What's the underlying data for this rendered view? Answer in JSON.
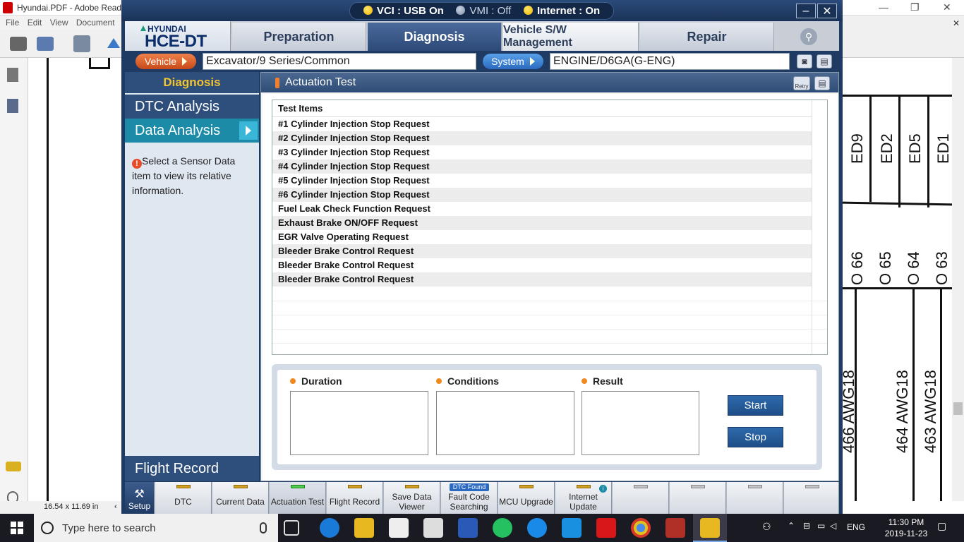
{
  "background": {
    "title": "Hyundai.PDF - Adobe Reade",
    "menu": [
      "File",
      "Edit",
      "View",
      "Document"
    ],
    "page_size": "16.54 x 11.69 in",
    "schematic_labels": [
      "ED9",
      "ED2",
      "ED5",
      "ED1"
    ],
    "pin_labels": [
      "O 66",
      "O 65",
      "O 64",
      "O 63"
    ],
    "wire_labels": [
      "466 AWG18",
      "464 AWG18",
      "463 AWG18"
    ]
  },
  "app": {
    "status": {
      "vci": "VCI : USB On",
      "vmi": "VMI : Off",
      "internet": "Internet : On"
    },
    "logo_brand": "HYUNDAI",
    "logo_product": "HCE-DT",
    "tabs": [
      "Preparation",
      "Diagnosis",
      "Vehicle S/W Management",
      "Repair"
    ],
    "vehicle_label": "Vehicle",
    "vehicle_value": "Excavator/9 Series/Common",
    "system_label": "System",
    "system_value": "ENGINE/D6GA(G-ENG)"
  },
  "sidebar": {
    "header": "Diagnosis",
    "items": [
      "DTC Analysis",
      "Data Analysis"
    ],
    "info_text": "Select a Sensor Data item to view its relative information.",
    "footer": "Flight Record"
  },
  "main": {
    "title": "Actuation Test",
    "retry_label": "Retry",
    "table_header": "Test Items",
    "items": [
      "#1 Cylinder Injection Stop Request",
      "#2 Cylinder Injection Stop Request",
      "#3 Cylinder Injection Stop Request",
      "#4 Cylinder Injection Stop Request",
      "#5 Cylinder Injection Stop Request",
      "#6 Cylinder Injection Stop Request",
      "Fuel Leak Check Function Request",
      "Exhaust Brake ON/OFF Request",
      "EGR Valve Operating Request",
      "Bleeder Brake Control Request",
      "Bleeder Brake Control Request",
      "Bleeder Brake Control Request"
    ],
    "duration_label": "Duration",
    "conditions_label": "Conditions",
    "result_label": "Result",
    "start_label": "Start",
    "stop_label": "Stop"
  },
  "toolbar": {
    "setup": "Setup",
    "buttons": [
      "DTC",
      "Current Data",
      "Actuation Test",
      "Flight Record",
      "Save Data Viewer",
      "Fault Code Searching",
      "MCU Upgrade",
      "Internet Update"
    ],
    "dtc_found_badge": "DTC Found"
  },
  "taskbar": {
    "search_placeholder": "Type here to search",
    "lang": "ENG",
    "time": "11:30 PM",
    "date": "2019-11-23"
  }
}
